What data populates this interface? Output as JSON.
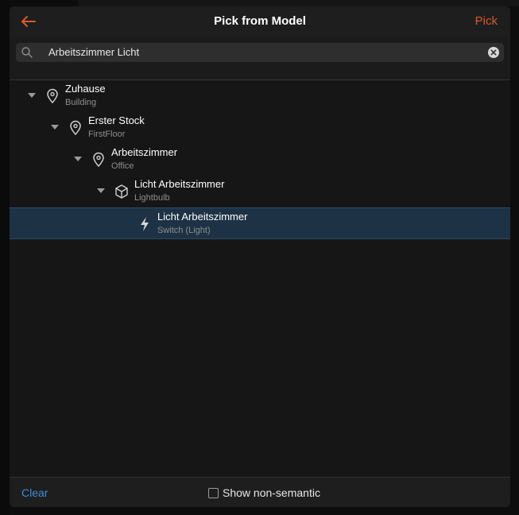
{
  "navbar": {
    "title": "Pick from Model",
    "back_icon": "arrow-left-icon",
    "pick_label": "Pick"
  },
  "search": {
    "value": "Arbeitszimmer Licht",
    "placeholder": "Search",
    "search_icon": "search-icon",
    "clear_icon": "clear-circle-icon"
  },
  "tree": {
    "nodes": [
      {
        "title": "Zuhause",
        "subtitle": "Building",
        "icon": "location-pin-icon",
        "expanded": true
      },
      {
        "title": "Erster Stock",
        "subtitle": "FirstFloor",
        "icon": "location-pin-icon",
        "expanded": true
      },
      {
        "title": "Arbeitszimmer",
        "subtitle": "Office",
        "icon": "location-pin-icon",
        "expanded": true
      },
      {
        "title": "Licht Arbeitszimmer",
        "subtitle": "Lightbulb",
        "icon": "cube-icon",
        "expanded": true
      },
      {
        "title": "Licht Arbeitszimmer",
        "subtitle": "Switch (Light)",
        "icon": "bolt-icon",
        "selected": true
      }
    ]
  },
  "toolbar": {
    "clear_label": "Clear",
    "nonsemantic_label": "Show non-semantic",
    "nonsemantic_checked": false
  },
  "colors": {
    "accent": "#d95a2b",
    "link": "#3d8fd8",
    "selected_row": "#1d3245"
  }
}
